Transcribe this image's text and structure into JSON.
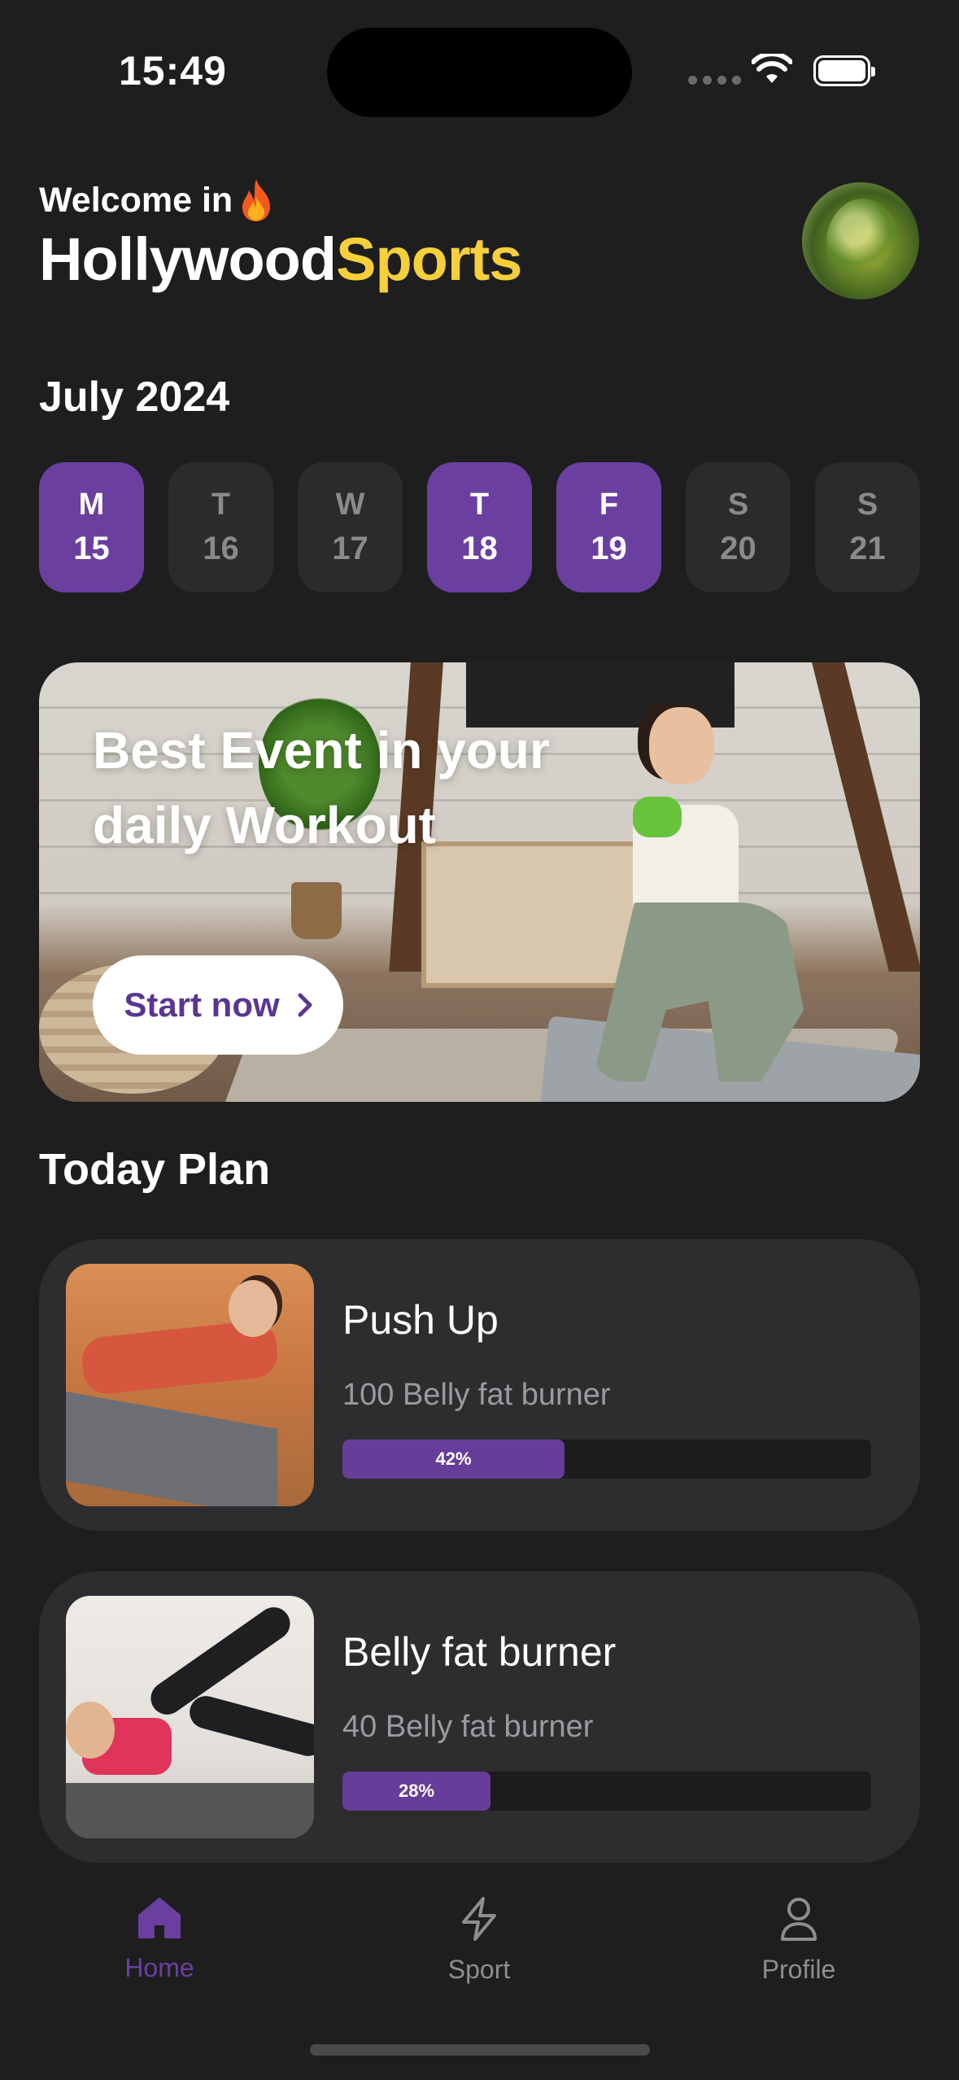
{
  "status_bar": {
    "time": "15:49"
  },
  "header": {
    "welcome": "Welcome in",
    "brand_part1": "Hollywood",
    "brand_part2": "Sports"
  },
  "calendar": {
    "month": "July 2024",
    "days": [
      {
        "name": "M",
        "date": "15",
        "active": true
      },
      {
        "name": "T",
        "date": "16",
        "active": false
      },
      {
        "name": "W",
        "date": "17",
        "active": false
      },
      {
        "name": "T",
        "date": "18",
        "active": true
      },
      {
        "name": "F",
        "date": "19",
        "active": true
      },
      {
        "name": "S",
        "date": "20",
        "active": false
      },
      {
        "name": "S",
        "date": "21",
        "active": false
      }
    ]
  },
  "banner": {
    "title_line1": "Best Event in your",
    "title_line2": "daily Workout",
    "button": "Start now"
  },
  "plan": {
    "title": "Today Plan",
    "items": [
      {
        "title": "Push Up",
        "subtitle": "100 Belly fat burner",
        "progress_label": "42%",
        "progress": 0.42
      },
      {
        "title": "Belly fat burner",
        "subtitle": "40 Belly fat burner",
        "progress_label": "28%",
        "progress": 0.28
      }
    ]
  },
  "tabs": [
    {
      "label": "Home",
      "icon": "home-icon",
      "active": true
    },
    {
      "label": "Sport",
      "icon": "lightning-icon",
      "active": false
    },
    {
      "label": "Profile",
      "icon": "user-icon",
      "active": false
    }
  ],
  "colors": {
    "background": "#1e1e1f",
    "accent": "#6a3fa0",
    "brand_yellow": "#f6cf3b",
    "card": "#2d2d2f"
  }
}
